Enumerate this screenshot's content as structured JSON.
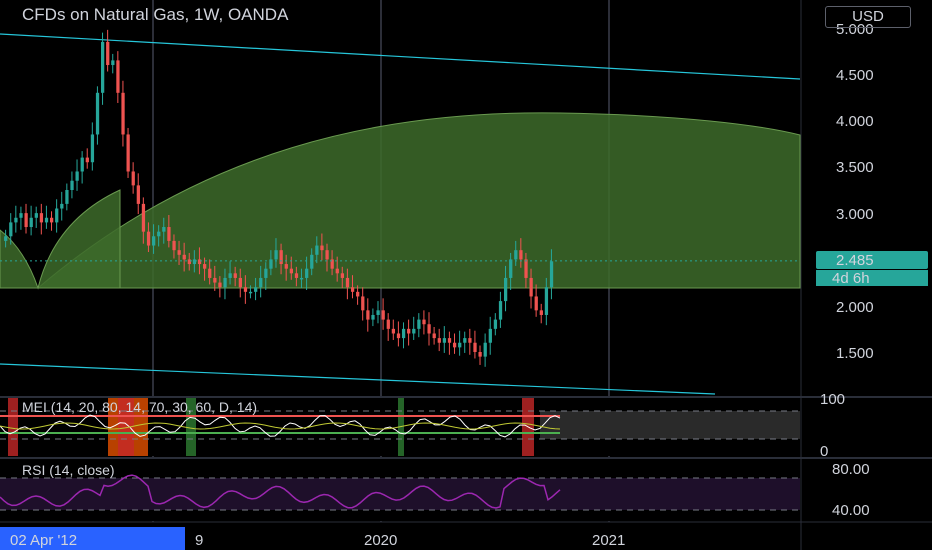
{
  "header": {
    "title": "CFDs on Natural Gas, 1W, OANDA",
    "currency": "USD"
  },
  "price_axis": {
    "ticks": [
      "5.000",
      "4.500",
      "4.000",
      "3.500",
      "3.000",
      "2.485",
      "2.000",
      "1.500"
    ],
    "last_price": "2.485",
    "countdown": "4d 6h"
  },
  "time_axis": {
    "labels": [
      "2020",
      "2021"
    ],
    "cursor_label": "02 Apr '12",
    "partial_label": "9"
  },
  "mei": {
    "label": "MEI (14, 20, 80, 14, 70, 30, 60, D, 14)",
    "ticks": [
      "100",
      "0"
    ]
  },
  "rsi": {
    "label": "RSI (14, close)",
    "ticks": [
      "80.00",
      "40.00"
    ]
  },
  "colors": {
    "bull": "#26a69a",
    "bear": "#ef5350",
    "channel": "#26c6da",
    "arc_fill": "#3d6b2a",
    "rsi_line": "#9c27b0",
    "rsi_bg": "#1e0f2a"
  },
  "chart_data": {
    "type": "candlestick",
    "y_range": [
      1.15,
      5.2
    ],
    "closes": [
      2.75,
      2.9,
      2.95,
      3.0,
      2.85,
      2.95,
      3.0,
      2.9,
      2.95,
      2.9,
      3.05,
      3.1,
      3.25,
      3.35,
      3.45,
      3.6,
      3.55,
      3.85,
      4.3,
      4.85,
      4.6,
      4.65,
      4.3,
      3.85,
      3.45,
      3.3,
      3.1,
      2.8,
      2.65,
      2.75,
      2.8,
      2.85,
      2.7,
      2.6,
      2.55,
      2.5,
      2.45,
      2.5,
      2.45,
      2.4,
      2.3,
      2.25,
      2.2,
      2.3,
      2.35,
      2.3,
      2.2,
      2.15,
      2.15,
      2.2,
      2.3,
      2.4,
      2.5,
      2.6,
      2.45,
      2.4,
      2.35,
      2.3,
      2.3,
      2.4,
      2.55,
      2.65,
      2.6,
      2.5,
      2.4,
      2.35,
      2.3,
      2.2,
      2.15,
      2.1,
      1.95,
      1.85,
      1.9,
      1.95,
      1.85,
      1.75,
      1.7,
      1.65,
      1.75,
      1.7,
      1.75,
      1.85,
      1.8,
      1.7,
      1.65,
      1.6,
      1.65,
      1.6,
      1.55,
      1.6,
      1.65,
      1.6,
      1.5,
      1.45,
      1.6,
      1.75,
      1.85,
      2.05,
      2.3,
      2.5,
      2.6,
      2.5,
      2.3,
      2.1,
      1.95,
      1.9,
      2.2,
      2.48
    ]
  }
}
